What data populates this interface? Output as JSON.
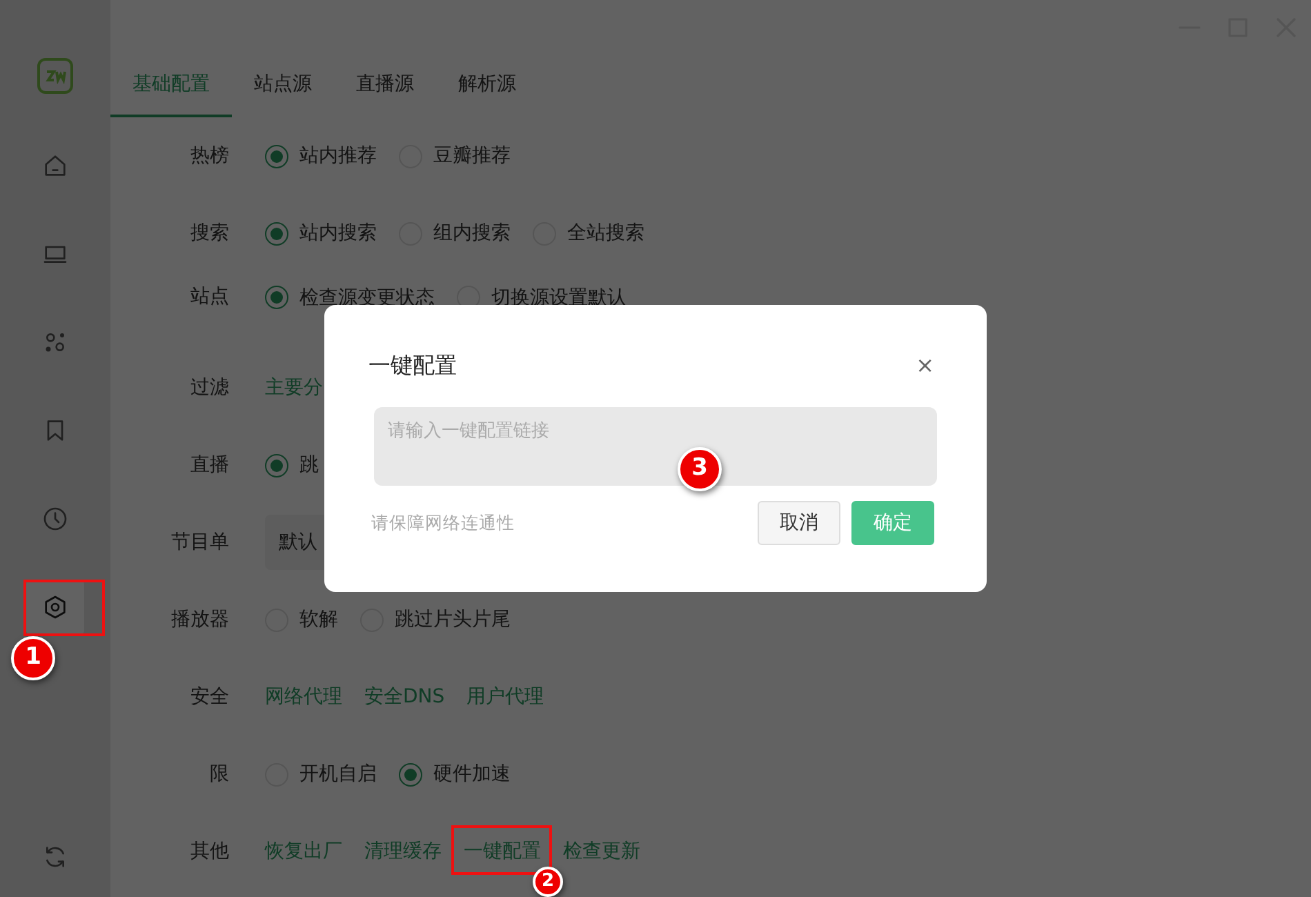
{
  "sidebar": {
    "items": [
      {
        "kind": "home",
        "selected": false
      },
      {
        "kind": "laptop",
        "selected": false
      },
      {
        "kind": "dots",
        "selected": false
      },
      {
        "kind": "bookmark",
        "selected": false
      },
      {
        "kind": "clock",
        "selected": false
      },
      {
        "kind": "settings",
        "selected": true
      },
      {
        "kind": "refresh",
        "selected": false
      }
    ]
  },
  "tabs": [
    {
      "label": "基础配置",
      "selected": true
    },
    {
      "label": "站点源",
      "selected": false
    },
    {
      "label": "直播源",
      "selected": false
    },
    {
      "label": "解析源",
      "selected": false
    }
  ],
  "settings": [
    {
      "label": "热榜",
      "kind": "radio",
      "options": [
        {
          "label": "站内推荐",
          "selected": true
        },
        {
          "label": "豆瓣推荐",
          "selected": false
        }
      ]
    },
    {
      "label": "搜索",
      "kind": "radio",
      "options": [
        {
          "label": "站内搜索",
          "selected": true
        },
        {
          "label": "组内搜索",
          "selected": false
        },
        {
          "label": "全站搜索",
          "selected": false
        }
      ]
    },
    {
      "label": "站点",
      "kind": "radio",
      "options": [
        {
          "label": "检查源变更状态",
          "selected": true
        },
        {
          "label": "切换源设置默认",
          "selected": false
        }
      ]
    },
    {
      "label": "过滤",
      "kind": "links",
      "links": [
        "主要分"
      ]
    },
    {
      "label": "直播",
      "kind": "radio",
      "options": [
        {
          "label": "跳",
          "selected": true
        }
      ]
    },
    {
      "label": "节目单",
      "kind": "select",
      "value": "默认"
    },
    {
      "label": "播放器",
      "kind": "radio",
      "options": [
        {
          "label": "软解",
          "selected": false
        },
        {
          "label": "跳过片头片尾",
          "selected": false
        }
      ]
    },
    {
      "label": "安全",
      "kind": "links",
      "links": [
        "网络代理",
        "安全DNS",
        "用户代理"
      ]
    },
    {
      "label": "限",
      "kind": "radio",
      "options": [
        {
          "label": "开机自启",
          "selected": false
        },
        {
          "label": "硬件加速",
          "selected": true
        }
      ]
    },
    {
      "label": "其他",
      "kind": "links",
      "links": [
        "恢复出厂",
        "清理缓存",
        "一键配置",
        "检查更新"
      ]
    }
  ],
  "dialog": {
    "title": "一键配置",
    "close": "×",
    "input": {
      "placeholder": "请输入一键配置链接"
    },
    "hint": "请保障网络连通性",
    "buttons": [
      {
        "label": "取消",
        "kind": "secondary"
      },
      {
        "label": "确定",
        "kind": "primary"
      }
    ]
  },
  "annotations": [
    {
      "label": "1",
      "boxed": true
    },
    {
      "label": "2",
      "boxed": true
    },
    {
      "label": "3",
      "boxed": false
    }
  ]
}
